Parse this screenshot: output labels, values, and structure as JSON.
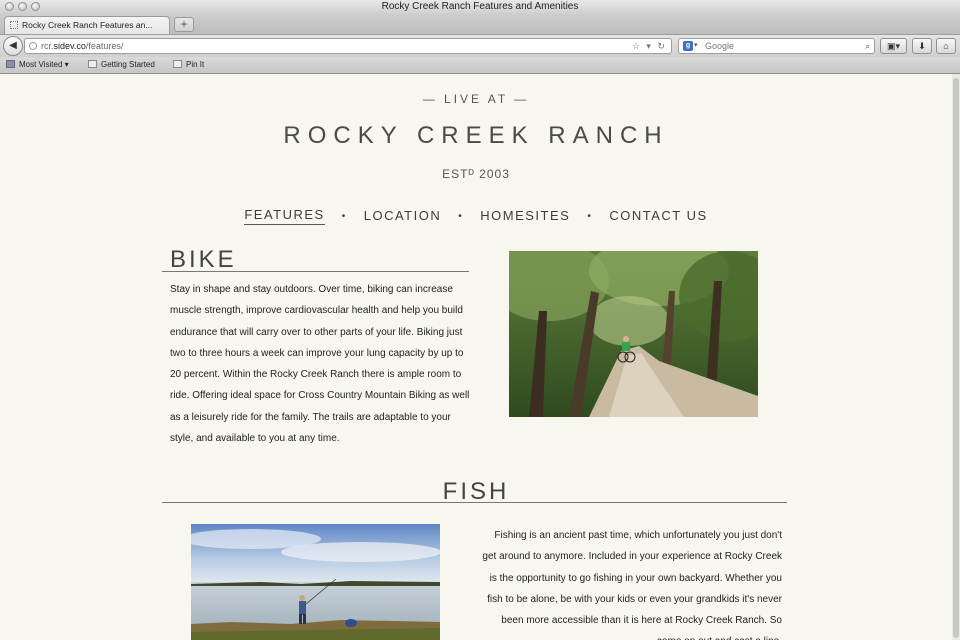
{
  "window": {
    "title": "Rocky Creek Ranch Features and Amenities"
  },
  "tabs": [
    {
      "label": "Rocky Creek Ranch Features an..."
    }
  ],
  "newtab_label": "+",
  "url": {
    "prefix": "rcr.",
    "domain": "sidev.co",
    "path": "/features/"
  },
  "search": {
    "engine": "Google",
    "placeholder": "Google"
  },
  "bookmarks": [
    "Most Visited",
    "Getting Started",
    "Pin It"
  ],
  "site": {
    "live_at": "— LIVE AT —",
    "name": "ROCKY CREEK RANCH",
    "established": "ESTᴰ 2003",
    "nav": [
      {
        "label": "FEATURES",
        "active": true
      },
      {
        "label": "LOCATION",
        "active": false
      },
      {
        "label": "HOMESITES",
        "active": false
      },
      {
        "label": "CONTACT US",
        "active": false
      }
    ],
    "nav_separator": "•"
  },
  "sections": {
    "bike": {
      "title": "BIKE",
      "text": "Stay in shape and stay outdoors. Over time, biking can increase muscle strength, improve cardiovascular health and help you build endurance that will carry over to other parts of your life. Biking just two to three hours a week can improve your lung capacity by up to 20 percent. Within the Rocky Creek Ranch there is ample room to ride. Offering ideal space for Cross Country Mountain Biking as well as a leisurely ride for the family. The trails are adaptable to your style, and available to you at any time."
    },
    "fish": {
      "title": "FISH",
      "text": "Fishing is an ancient past time, which unfortunately you just don't get around to anymore. Included in your experience at Rocky Creek is the opportunity to go fishing in your own backyard. Whether you fish to be alone, be with your kids or even your grandkids it's never been more accessible than it is here at Rocky Creek Ranch. So come on out and cast a line."
    }
  },
  "colors": {
    "page_background": "#f7f6ef",
    "text": "#3a3a3a"
  }
}
